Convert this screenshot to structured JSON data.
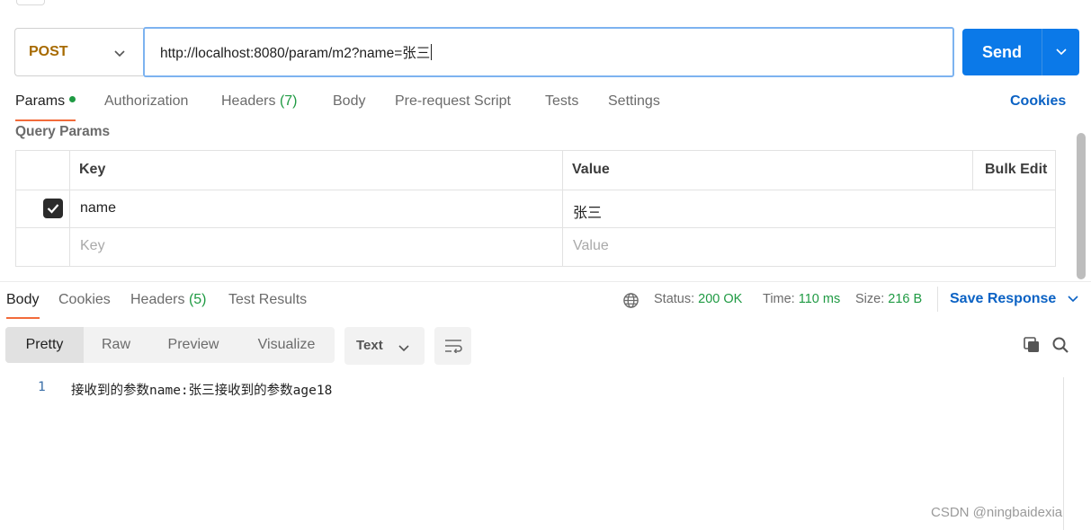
{
  "request": {
    "method": "POST",
    "url": "http://localhost:8080/param/m2?name=张三",
    "send_label": "Send"
  },
  "request_tabs": [
    {
      "label": "Params",
      "active": true,
      "has_dot": true
    },
    {
      "label": "Authorization"
    },
    {
      "label": "Headers",
      "count": "(7)"
    },
    {
      "label": "Body"
    },
    {
      "label": "Pre-request Script"
    },
    {
      "label": "Tests"
    },
    {
      "label": "Settings"
    }
  ],
  "cookies_label": "Cookies",
  "query_params": {
    "title": "Query Params",
    "headers": {
      "key": "Key",
      "value": "Value",
      "bulk_edit": "Bulk Edit"
    },
    "rows": [
      {
        "checked": true,
        "key": "name",
        "value": "张三"
      }
    ],
    "placeholder": {
      "key": "Key",
      "value": "Value"
    }
  },
  "response_tabs": [
    {
      "label": "Body",
      "active": true
    },
    {
      "label": "Cookies"
    },
    {
      "label": "Headers",
      "count": "(5)"
    },
    {
      "label": "Test Results"
    }
  ],
  "status": {
    "status_label": "Status:",
    "status_value": "200 OK",
    "time_label": "Time:",
    "time_value": "110 ms",
    "size_label": "Size:",
    "size_value": "216 B"
  },
  "save_response_label": "Save Response",
  "view_modes": [
    "Pretty",
    "Raw",
    "Preview",
    "Visualize"
  ],
  "format": "Text",
  "body": {
    "line_number": "1",
    "line": "接收到的参数name:张三接收到的参数age18"
  },
  "watermark": "CSDN @ningbaidexia",
  "icons": {
    "method_dropdown": "chevron-down-icon",
    "send_dropdown": "chevron-down-icon",
    "checkbox": "check-icon",
    "network": "globe-icon",
    "wrap": "wrap-lines-icon",
    "copy": "copy-icon",
    "search": "search-icon"
  },
  "colors": {
    "send": "#0b79e8",
    "method": "#a76a00",
    "success": "#1f9a43",
    "link": "#0b62c4",
    "active_tab_underline": "#f26b3a"
  }
}
